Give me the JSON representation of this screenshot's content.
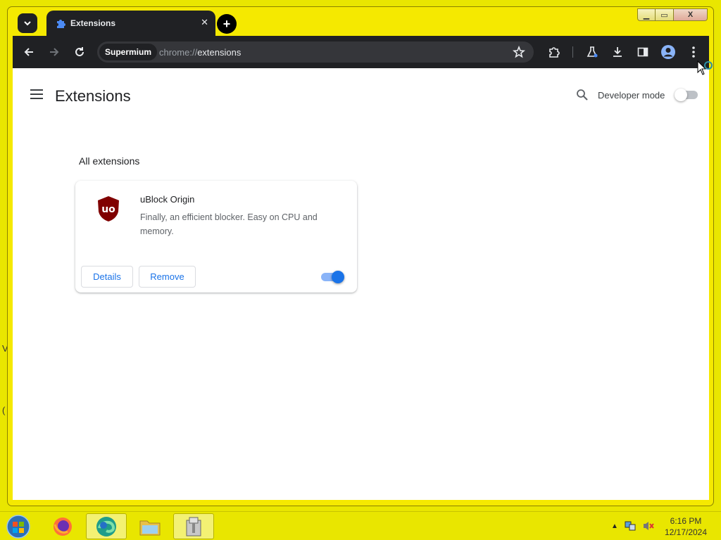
{
  "tab": {
    "title": "Extensions",
    "close": "✕"
  },
  "newtab_label": "+",
  "toolbar": {
    "chip": "Supermium",
    "url_scheme": "chrome://",
    "url_path": "extensions"
  },
  "page": {
    "title": "Extensions",
    "developer_mode_label": "Developer mode",
    "developer_mode_on": false
  },
  "section_title": "All extensions",
  "extensions": [
    {
      "name": "uBlock Origin",
      "description": "Finally, an efficient blocker. Easy on CPU and memory.",
      "details_label": "Details",
      "remove_label": "Remove",
      "enabled": true,
      "icon": "ublock-shield-icon",
      "icon_text": "uo"
    }
  ],
  "window_controls": {
    "minimize": "▁",
    "maximize": "▭",
    "close": "X"
  },
  "taskbar": {
    "apps": [
      "firefox-icon",
      "edge-icon",
      "file-explorer-icon",
      "archive-icon"
    ],
    "clock": {
      "time": "6:16 PM",
      "date": "12/17/2024"
    },
    "tray_arrow": "▲"
  },
  "colors": {
    "accent": "#1a73e8",
    "toolbar": "#202124",
    "desktop": "#e9e600",
    "ublock_red": "#800000"
  }
}
